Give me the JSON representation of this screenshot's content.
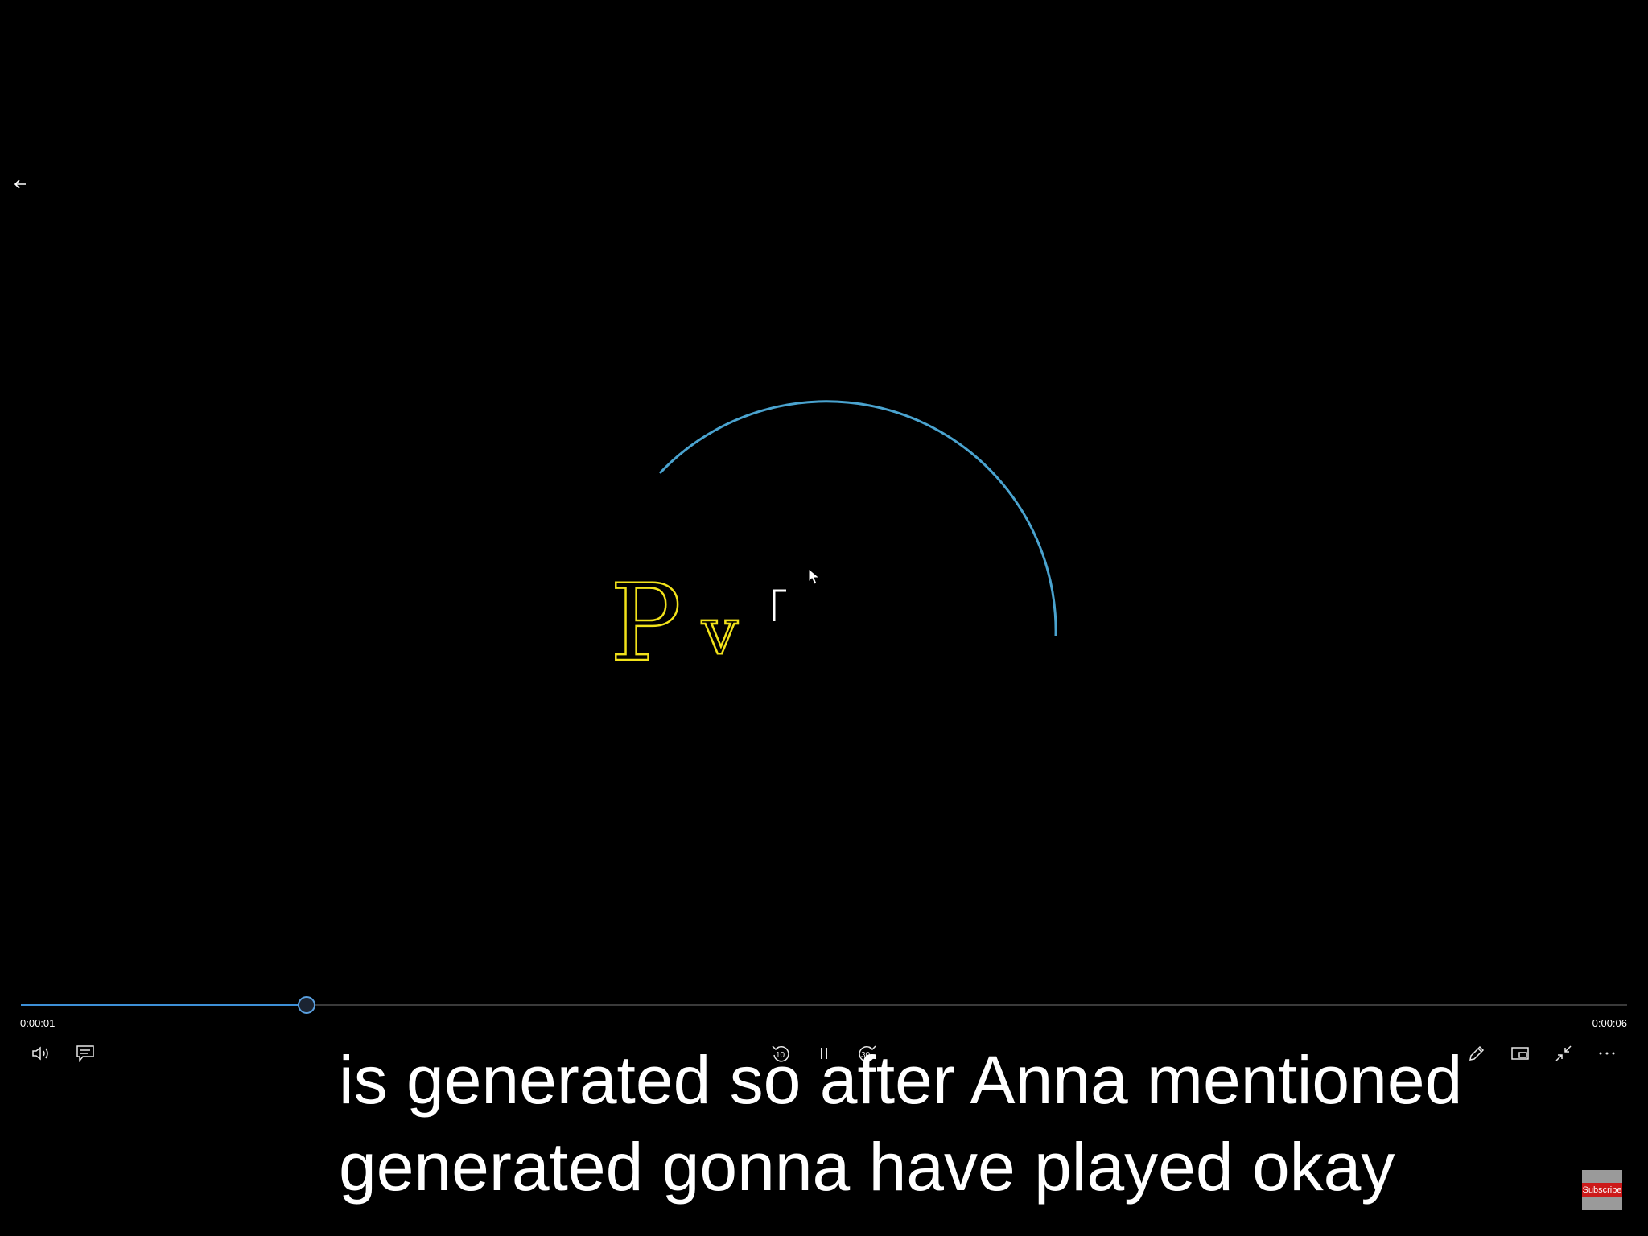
{
  "player": {
    "current_time": "0:00:01",
    "total_time": "0:00:06",
    "progress_fraction": 0.178,
    "accent_color": "#3d8fd6",
    "skip_back_seconds": "10",
    "skip_forward_seconds": "30"
  },
  "video_frame": {
    "symbol_main": "P",
    "symbol_sub": "v",
    "symbol_color": "#f2e21a",
    "arc_color": "#4aa3cf"
  },
  "captions": {
    "line1": "is generated so after Anna mentioned",
    "line2": "generated gonna have played okay"
  },
  "watermark": {
    "label": "Subscribe",
    "color": "#cc1a1a"
  },
  "icons": {
    "back": "arrow-left-icon",
    "volume": "volume-icon",
    "subtitles": "subtitles-icon",
    "skip_back": "rewind-10-icon",
    "play_pause": "pause-icon",
    "skip_forward": "forward-30-icon",
    "edit": "pencil-icon",
    "mini_view": "mini-view-icon",
    "exit_fullscreen": "exit-fullscreen-icon",
    "more": "more-icon"
  }
}
